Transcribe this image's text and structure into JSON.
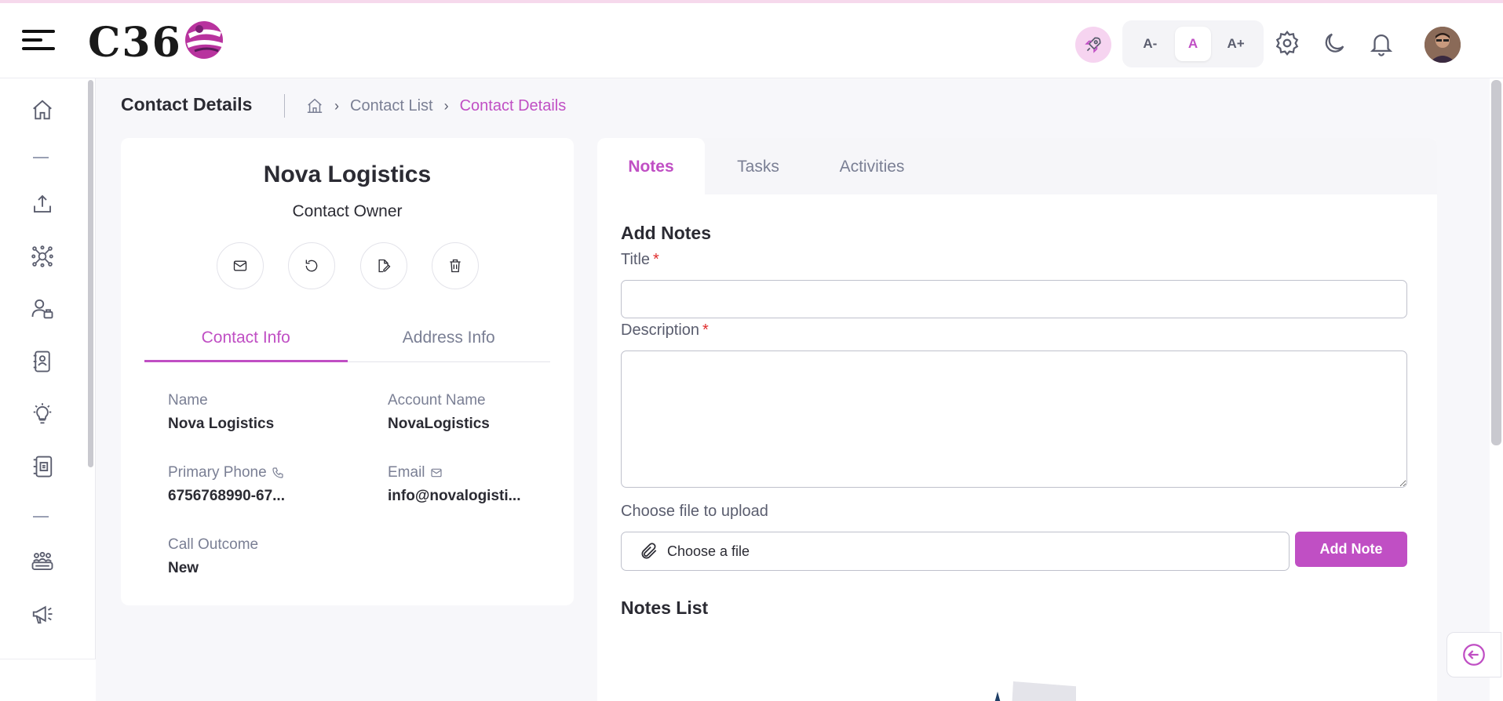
{
  "header": {
    "logo_text": "C36",
    "font_controls": [
      "A-",
      "A",
      "A+"
    ],
    "active_font_control": "A"
  },
  "breadcrumb": {
    "page_title": "Contact Details",
    "items": [
      "Contact List",
      "Contact Details"
    ]
  },
  "contact": {
    "company": "Nova Logistics",
    "owner_label": "Contact Owner",
    "tabs": [
      "Contact Info",
      "Address Info"
    ],
    "fields": {
      "name_label": "Name",
      "name_value": "Nova Logistics",
      "account_label": "Account Name",
      "account_value": "NovaLogistics",
      "phone_label": "Primary Phone",
      "phone_value": "6756768990-67...",
      "email_label": "Email",
      "email_value": "info@novalogisti...",
      "outcome_label": "Call Outcome",
      "outcome_value": "New"
    }
  },
  "detail_tabs": [
    "Notes",
    "Tasks",
    "Activities"
  ],
  "notes_form": {
    "heading": "Add Notes",
    "title_label": "Title",
    "description_label": "Description",
    "required_mark": "*",
    "upload_label": "Choose file to upload",
    "file_placeholder": "Choose a file",
    "submit_label": "Add Note",
    "list_heading": "Notes List"
  },
  "colors": {
    "accent": "#c04fc4",
    "required": "#e02d2d",
    "muted": "#7a7f94"
  },
  "icons": {
    "sidebar": [
      "home-icon",
      "upload-icon",
      "network-icon",
      "user-group-icon",
      "contact-book-icon",
      "lightbulb-icon",
      "contact-card-icon",
      "team-icon",
      "megaphone-icon"
    ],
    "actions": [
      "mail-icon",
      "refresh-icon",
      "edit-icon",
      "trash-icon"
    ]
  }
}
